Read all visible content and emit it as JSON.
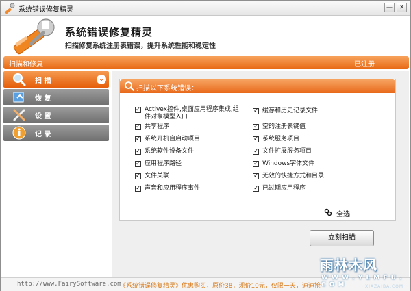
{
  "window": {
    "title": "系统错误修复精灵",
    "min_label": "—",
    "close_label": "✕"
  },
  "header": {
    "app_name": "系统错误修复精灵",
    "description": "扫描修复系统注册表错误，提升系统性能和稳定性"
  },
  "band": {
    "left": "扫描和修复",
    "right": "已注册"
  },
  "sidebar": {
    "items": [
      {
        "label": "扫 描",
        "icon": "magnifier-icon",
        "active": true
      },
      {
        "label": "恢 复",
        "icon": "restore-icon",
        "active": false
      },
      {
        "label": "设 置",
        "icon": "tools-icon",
        "active": false
      },
      {
        "label": "记 录",
        "icon": "info-icon",
        "active": false
      }
    ],
    "chevron": "⌄"
  },
  "scan": {
    "title": "扫描以下系统错误：",
    "left_items": [
      "Activex控件,桌面应用程序集成,组件对象模型入口",
      "共享程序",
      "系统开机自启动项目",
      "系统软件设备文件",
      "应用程序路径",
      "文件关联",
      "声音和应用程序事件"
    ],
    "right_items": [
      "缓存和历史记录文件",
      "空的注册表键值",
      "系统服务项目",
      "文件扩展服务项目",
      "Windows字体文件",
      "无效的快捷方式和目录",
      "已过期应用程序"
    ],
    "check_mark": "✓",
    "select_all": "全选",
    "scan_button": "立刻扫描"
  },
  "footer": {
    "url": "http://www.FairySoftware.com",
    "promo": "《系统错误修复精灵》优惠购买，原价38，现价10元，仅限一天，速速抢"
  },
  "watermark": {
    "big": "雨林木风",
    "small": "W W W . Y L M F U . C O M",
    "tiny": "XIAZAIBA.COM"
  },
  "colors": {
    "accent": "#e8691a",
    "accent_light": "#f6a462",
    "sidebar_gray": "#7f7f7f"
  }
}
